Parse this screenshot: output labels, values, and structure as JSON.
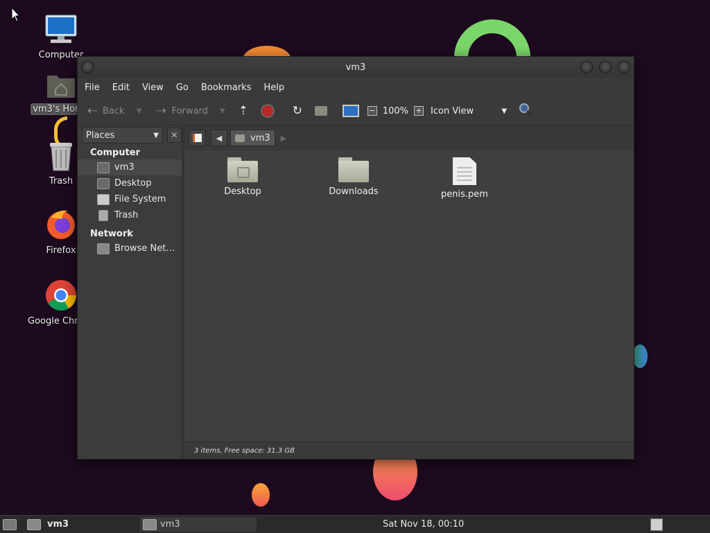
{
  "desktop": {
    "icons": [
      {
        "label": "Computer",
        "icon": "computer-icon"
      },
      {
        "label": "vm3's Home",
        "icon": "home-folder-icon"
      },
      {
        "label": "Trash",
        "icon": "trash-icon"
      },
      {
        "label": "Firefox",
        "icon": "firefox-icon"
      },
      {
        "label": "Google Chrome",
        "icon": "chrome-icon"
      }
    ]
  },
  "window": {
    "title": "vm3",
    "menu": [
      "File",
      "Edit",
      "View",
      "Go",
      "Bookmarks",
      "Help"
    ],
    "toolbar": {
      "back_label": "Back",
      "forward_label": "Forward",
      "zoom_level": "100%",
      "view_mode": "Icon View"
    },
    "sidebar": {
      "combo_label": "Places",
      "sections": [
        {
          "title": "Computer",
          "items": [
            "vm3",
            "Desktop",
            "File System",
            "Trash"
          ]
        },
        {
          "title": "Network",
          "items": [
            "Browse Net…"
          ]
        }
      ],
      "selected": "vm3"
    },
    "pathbar": {
      "current": "vm3"
    },
    "files": [
      {
        "name": "Desktop",
        "type": "folder-desktop"
      },
      {
        "name": "Downloads",
        "type": "folder"
      },
      {
        "name": "penis.pem",
        "type": "text-file"
      }
    ],
    "status": "3 items, Free space: 31.3 GB"
  },
  "taskbar": {
    "workspace_label": "vm3",
    "task_label": "vm3",
    "clock": "Sat Nov 18, 00:10"
  },
  "colors": {
    "desktop_bg": "#1d0a1f",
    "window_bg": "#3f3f3f"
  }
}
